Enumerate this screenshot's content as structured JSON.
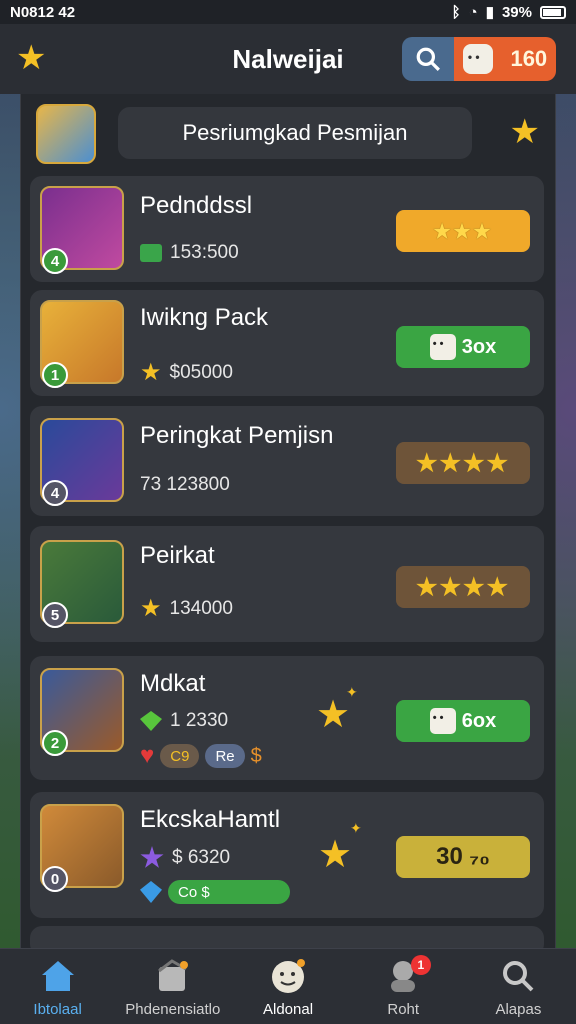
{
  "status_bar": {
    "time": "N0812 42",
    "battery": "39%"
  },
  "header": {
    "title": "Nalweijai",
    "coins": "160"
  },
  "rank_header": {
    "title": "Pesriumgkad Pesmijan"
  },
  "cards": [
    {
      "rank": "4",
      "name": "Pednddssl",
      "stat": "153:500",
      "action": "★★★",
      "action_style": "gold"
    },
    {
      "rank": "1",
      "name": "Iwikng Pack",
      "stat": "$05000",
      "action": "3ox",
      "action_style": "green"
    },
    {
      "rank": "4",
      "name": "Peringkat Pemjisn",
      "stat": "73 123800",
      "action": "★★★★",
      "action_style": "brown"
    },
    {
      "rank": "5",
      "name": "Peirkat",
      "stat": "134000",
      "action": "★★★★",
      "action_style": "brown"
    },
    {
      "rank": "2",
      "name": "Mdkat",
      "stat": "1 2330",
      "extra_a": "C9",
      "extra_b": "Re",
      "action": "6ox",
      "action_style": "green"
    },
    {
      "rank": "0",
      "name": "EkcskaHamtl",
      "stat": "$ 6320",
      "extra_a": "Co $",
      "action": "30 ₇₀",
      "action_style": "olive"
    }
  ],
  "nav": [
    {
      "label": "Ibtolaal",
      "icon": "home-icon"
    },
    {
      "label": "Phdenensiatlo",
      "icon": "box-icon"
    },
    {
      "label": "Aldonal",
      "icon": "mascot-icon"
    },
    {
      "label": "Roht",
      "icon": "character-icon",
      "badge": "1"
    },
    {
      "label": "Alapas",
      "icon": "search-icon"
    }
  ]
}
